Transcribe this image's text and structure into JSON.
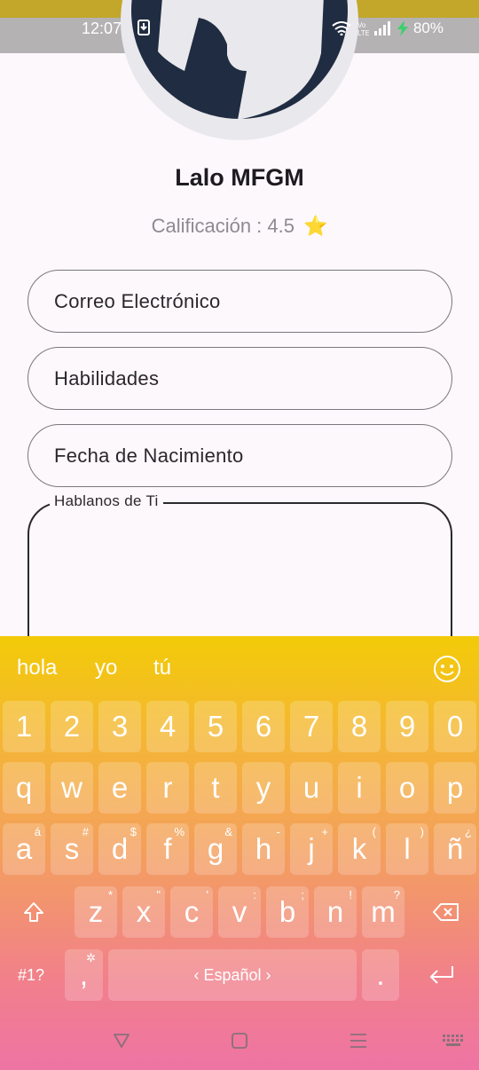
{
  "status": {
    "time": "12:07",
    "battery": "80%"
  },
  "profile": {
    "name": "Lalo MFGM",
    "rating_label": "Calificación : 4.5",
    "star": "⭐"
  },
  "form": {
    "email_placeholder": "Correo Electrónico",
    "skills_placeholder": "Habilidades",
    "birthdate_placeholder": "Fecha de Nacimiento",
    "about_label": "Hablanos de Ti"
  },
  "keyboard": {
    "suggestions": [
      "hola",
      "yo",
      "tú"
    ],
    "number_row": [
      "1",
      "2",
      "3",
      "4",
      "5",
      "6",
      "7",
      "8",
      "9",
      "0"
    ],
    "row1": [
      "q",
      "w",
      "e",
      "r",
      "t",
      "y",
      "u",
      "i",
      "o",
      "p"
    ],
    "row2": [
      {
        "k": "a",
        "h": "á"
      },
      {
        "k": "s",
        "h": "#"
      },
      {
        "k": "d",
        "h": "$"
      },
      {
        "k": "f",
        "h": "%"
      },
      {
        "k": "g",
        "h": "&"
      },
      {
        "k": "h",
        "h": "-"
      },
      {
        "k": "j",
        "h": "+"
      },
      {
        "k": "k",
        "h": "("
      },
      {
        "k": "l",
        "h": ")"
      },
      {
        "k": "ñ",
        "h": "¿"
      }
    ],
    "row3": [
      {
        "k": "z",
        "h": "*"
      },
      {
        "k": "x",
        "h": "\""
      },
      {
        "k": "c",
        "h": "'"
      },
      {
        "k": "v",
        "h": ":"
      },
      {
        "k": "b",
        "h": ";"
      },
      {
        "k": "n",
        "h": "!"
      },
      {
        "k": "m",
        "h": "?"
      }
    ],
    "symbols_label": "#1?",
    "comma": ",",
    "comma_hint": "✲",
    "space_label": "‹  Español  ›",
    "period": "."
  }
}
